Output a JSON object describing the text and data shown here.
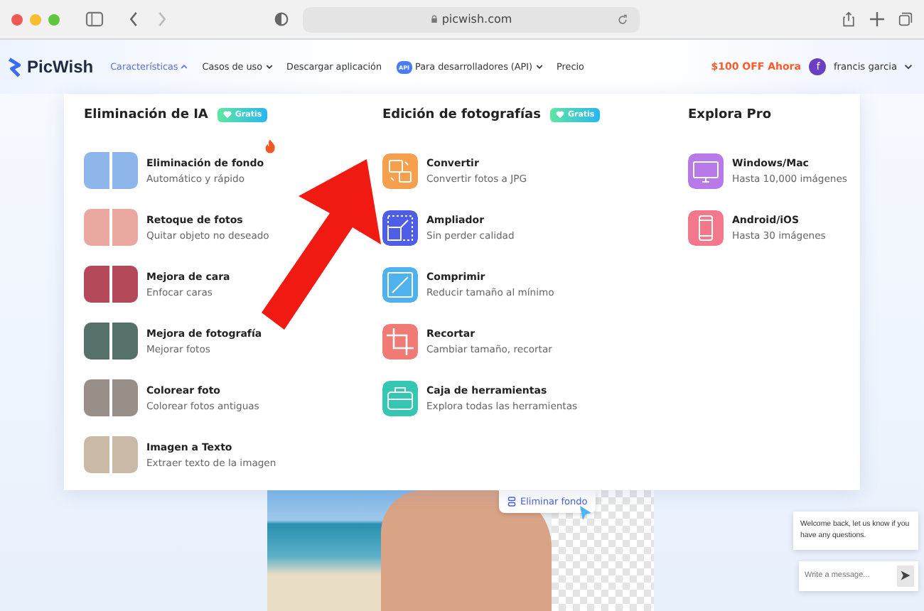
{
  "browser": {
    "url": "picwish.com"
  },
  "nav": {
    "logo": "PicWish",
    "items": [
      {
        "label": "Características",
        "selected": true,
        "caret": true
      },
      {
        "label": "Casos de uso",
        "selected": false,
        "caret": true
      },
      {
        "label": "Descargar aplicación",
        "selected": false,
        "caret": false
      },
      {
        "label": "Para desarrolladores (API)",
        "selected": false,
        "caret": true,
        "badge": "API"
      },
      {
        "label": "Precio",
        "selected": false,
        "caret": false
      }
    ],
    "promo": "$100 OFF Ahora",
    "user": {
      "initial": "f",
      "name": "francis garcia"
    }
  },
  "menu": [
    {
      "title": "Eliminación de IA",
      "badge": "Gratis",
      "items": [
        {
          "kind": "photo",
          "title": "Eliminación de fondo",
          "subtitle": "Automático y rápido",
          "hot": true,
          "color": "#8fb6ea"
        },
        {
          "kind": "photo",
          "title": "Retoque de fotos",
          "subtitle": "Quitar objeto no deseado",
          "hot": false,
          "color": "#e9a9a0"
        },
        {
          "kind": "photo",
          "title": "Mejora de cara",
          "subtitle": "Enfocar caras",
          "hot": false,
          "color": "#b4495a"
        },
        {
          "kind": "photo",
          "title": "Mejora de fotografía",
          "subtitle": "Mejorar fotos",
          "hot": false,
          "color": "#56706a"
        },
        {
          "kind": "photo",
          "title": "Colorear foto",
          "subtitle": "Colorear fotos antiguas",
          "hot": false,
          "color": "#9a8f88"
        },
        {
          "kind": "photo",
          "title": "Imagen a Texto",
          "subtitle": "Extraer texto de la imagen",
          "hot": false,
          "color": "#c9b9a6"
        }
      ]
    },
    {
      "title": "Edición de fotografías",
      "badge": "Gratis",
      "items": [
        {
          "kind": "icon",
          "title": "Convertir",
          "subtitle": "Convertir fotos a JPG",
          "hot": false,
          "color": "#f6a04d"
        },
        {
          "kind": "icon",
          "title": "Ampliador",
          "subtitle": "Sin perder calidad",
          "hot": false,
          "color": "#4f5ee9"
        },
        {
          "kind": "icon",
          "title": "Comprimir",
          "subtitle": "Reducir tamaño al mínimo",
          "hot": false,
          "color": "#4fb2ef"
        },
        {
          "kind": "icon",
          "title": "Recortar",
          "subtitle": "Cambiar tamaño, recortar",
          "hot": false,
          "color": "#ef7b74"
        },
        {
          "kind": "icon",
          "title": "Caja de herramientas",
          "subtitle": "Explora todas las herramientas",
          "hot": false,
          "color": "#36c7b3"
        }
      ]
    },
    {
      "title": "Explora Pro",
      "items": [
        {
          "kind": "icon",
          "title": "Windows/Mac",
          "subtitle": "Hasta 10,000 imágenes",
          "hot": false,
          "color": "#b77ae8"
        },
        {
          "kind": "icon",
          "title": "Android/iOS",
          "subtitle": "Hasta 30 imágenes",
          "hot": false,
          "color": "#f3788b"
        }
      ]
    }
  ],
  "hero": {
    "tooltip": "Eliminar fondo"
  },
  "chat": {
    "message": "Welcome back, let us know if you have any questions.",
    "placeholder": "Write a message..."
  }
}
